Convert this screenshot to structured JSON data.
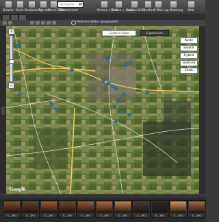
{
  "toolbar": {
    "items": [
      {
        "label": "Browse",
        "icon": "folder-icon"
      },
      {
        "label": "Karte",
        "icon": "map-icon"
      },
      {
        "label": "Bearbeitung",
        "icon": "edit-icon"
      },
      {
        "label": "Transfer",
        "icon": "transfer-icon"
      },
      {
        "label": "Movie Editor",
        "icon": "film-icon"
      },
      {
        "label": "Fokusmesstel",
        "icon": "focus-icon"
      },
      {
        "label": "Drehen n. links",
        "icon": "rotate-left-icon"
      },
      {
        "label": "Drehen n. rechts",
        "icon": "rotate-right-icon"
      },
      {
        "label": "Capture NX 2",
        "icon": "capture-icon"
      },
      {
        "label": "Drucken",
        "icon": "print-icon"
      },
      {
        "label": "E-Mail",
        "icon": "mail-icon"
      },
      {
        "label": "Log Matching",
        "icon": "log-icon"
      },
      {
        "label": "Web",
        "icon": "web-icon"
      }
    ],
    "search_placeholder": "Stichwörter"
  },
  "mapbar": {
    "selected_text": "Mehrere Bilder ausgewählt"
  },
  "map": {
    "search_button": "Suche in Karte",
    "results_label": "Ergebnissen",
    "types": [
      "Karte",
      "Satellit",
      "Hybrid",
      "Gelände",
      "Earth"
    ],
    "attribution": "Google"
  },
  "filmstrip": {
    "thumbs": [
      {
        "label": "S....JPG",
        "tone": "#8a4a2a"
      },
      {
        "label": "S....JPG",
        "tone": "#6e3d24"
      },
      {
        "label": "S....JPG",
        "tone": "#a05a30"
      },
      {
        "label": "S....JPG",
        "tone": "#7a4428"
      },
      {
        "label": "S....JPG",
        "tone": "#9a5a34"
      },
      {
        "label": "S....JPG",
        "tone": "#b56a3a"
      },
      {
        "label": "S....JPG",
        "tone": "#c38248"
      },
      {
        "label": "S....JPG",
        "tone": "#4a3a38"
      },
      {
        "label": "S....JPG",
        "tone": "#2a2a2a"
      },
      {
        "label": "S....JPG",
        "tone": "#d99a5a"
      },
      {
        "label": "S....JPG",
        "tone": "#a86a40"
      }
    ]
  },
  "colors": {
    "map_fields": "#5d6f38",
    "road_major": "#f2c94c",
    "road_minor": "#ffffff",
    "marker": "#2a7bd6",
    "toolbar_bg": "#4a4a4a"
  }
}
